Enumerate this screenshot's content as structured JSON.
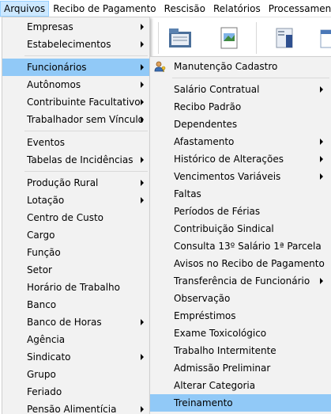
{
  "menubar": {
    "items": [
      {
        "label": "Arquivos"
      },
      {
        "label": "Recibo de Pagamento"
      },
      {
        "label": "Rescisão"
      },
      {
        "label": "Relatórios"
      },
      {
        "label": "Processamento M"
      }
    ]
  },
  "arquivos_menu": {
    "empresas": "Empresas",
    "estabelecimentos": "Estabelecimentos",
    "funcionarios": "Funcionários",
    "autonomos": "Autônomos",
    "contribuinte_facultativo": "Contribuinte Facultativo",
    "trabalhador_sem_vinculo": "Trabalhador sem Vínculo",
    "eventos": "Eventos",
    "tabelas_de_incidencias": "Tabelas de Incidências",
    "producao_rural": "Produção Rural",
    "lotacao": "Lotação",
    "centro_de_custo": "Centro de Custo",
    "cargo": "Cargo",
    "funcao": "Função",
    "setor": "Setor",
    "horario_de_trabalho": "Horário de Trabalho",
    "banco": "Banco",
    "banco_de_horas": "Banco de Horas",
    "agencia": "Agência",
    "sindicato": "Sindicato",
    "grupo": "Grupo",
    "feriado": "Feriado",
    "pensao_alimenticia": "Pensão Alimentícia"
  },
  "funcionarios_menu": {
    "manutencao_cadastro": "Manutenção Cadastro",
    "salario_contratual": "Salário Contratual",
    "recibo_padrao": "Recibo Padrão",
    "dependentes": "Dependentes",
    "afastamento": "Afastamento",
    "historico_de_alteracoes": "Histórico de Alterações",
    "vencimentos_variaveis": "Vencimentos Variáveis",
    "faltas": "Faltas",
    "periodos_de_ferias": "Períodos de Férias",
    "contribuicao_sindical": "Contribuição Sindical",
    "consulta_13_salario": "Consulta 13º Salário 1ª Parcela",
    "avisos_no_recibo": "Avisos no Recibo de Pagamento",
    "transferencia_de_funcionario": "Transferência de Funcionário",
    "observacao": "Observação",
    "emprestimos": "Empréstimos",
    "exame_toxicologico": "Exame Toxicológico",
    "trabalho_intermitente": "Trabalho Intermitente",
    "admissao_preliminar": "Admissão Preliminar",
    "alterar_categoria": "Alterar Categoria",
    "treinamento": "Treinamento"
  },
  "colors": {
    "menu_background": "#f2f2f2",
    "highlight": "#91c9f7",
    "menubar_active": "#cce8ff"
  },
  "icons": {
    "manutencao_cadastro": "user-key-icon",
    "toolbar_1": "folder-icon",
    "toolbar_2": "image-document-icon",
    "toolbar_3": "book-icon"
  }
}
